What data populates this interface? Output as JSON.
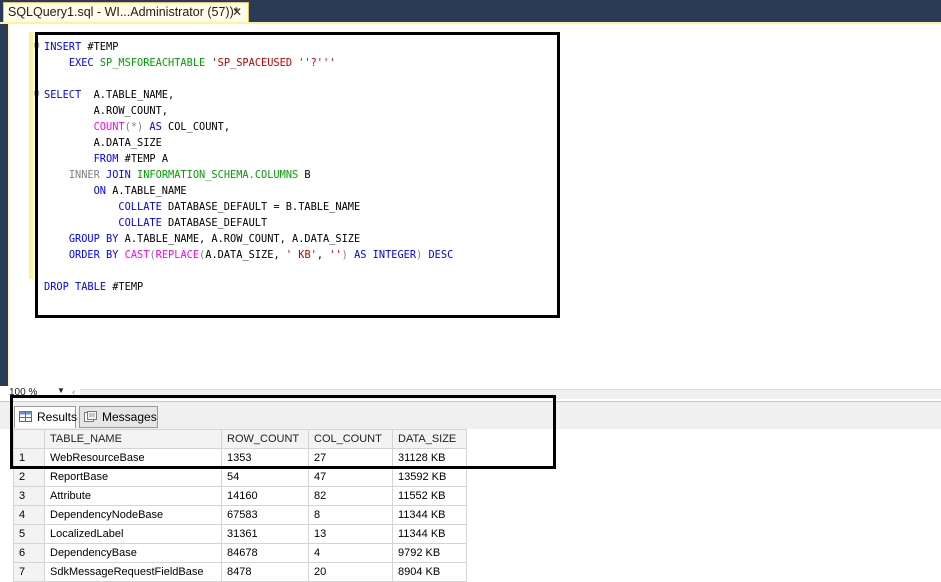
{
  "tab": {
    "title": "SQLQuery1.sql - WI...Administrator (57))*",
    "close": "✕"
  },
  "code_lines": [
    "INSERT #TEMP",
    "    EXEC SP_MSFOREACHTABLE 'SP_SPACEUSED ''?'''",
    "",
    "SELECT  A.TABLE_NAME,",
    "        A.ROW_COUNT,",
    "        COUNT(*) AS COL_COUNT,",
    "        A.DATA_SIZE",
    "        FROM #TEMP A",
    "    INNER JOIN INFORMATION_SCHEMA.COLUMNS B",
    "        ON A.TABLE_NAME",
    "            COLLATE DATABASE_DEFAULT = B.TABLE_NAME",
    "            COLLATE DATABASE_DEFAULT",
    "    GROUP BY A.TABLE_NAME, A.ROW_COUNT, A.DATA_SIZE",
    "    ORDER BY CAST(REPLACE(A.DATA_SIZE, ' KB', '') AS INTEGER) DESC",
    "",
    "DROP TABLE #TEMP"
  ],
  "zoom": "100 %",
  "results_tabs": [
    "Results",
    "Messages"
  ],
  "columns": [
    "",
    "TABLE_NAME",
    "ROW_COUNT",
    "COL_COUNT",
    "DATA_SIZE"
  ],
  "rows": [
    [
      "1",
      "WebResourceBase",
      "1353",
      "27",
      "31128 KB"
    ],
    [
      "2",
      "ReportBase",
      "54",
      "47",
      "13592 KB"
    ],
    [
      "3",
      "Attribute",
      "14160",
      "82",
      "11552 KB"
    ],
    [
      "4",
      "DependencyNodeBase",
      "67583",
      "8",
      "11344 KB"
    ],
    [
      "5",
      "LocalizedLabel",
      "31361",
      "13",
      "11344 KB"
    ],
    [
      "6",
      "DependencyBase",
      "84678",
      "4",
      "9792 KB"
    ],
    [
      "7",
      "SdkMessageRequestFieldBase",
      "8478",
      "20",
      "8904 KB"
    ]
  ]
}
